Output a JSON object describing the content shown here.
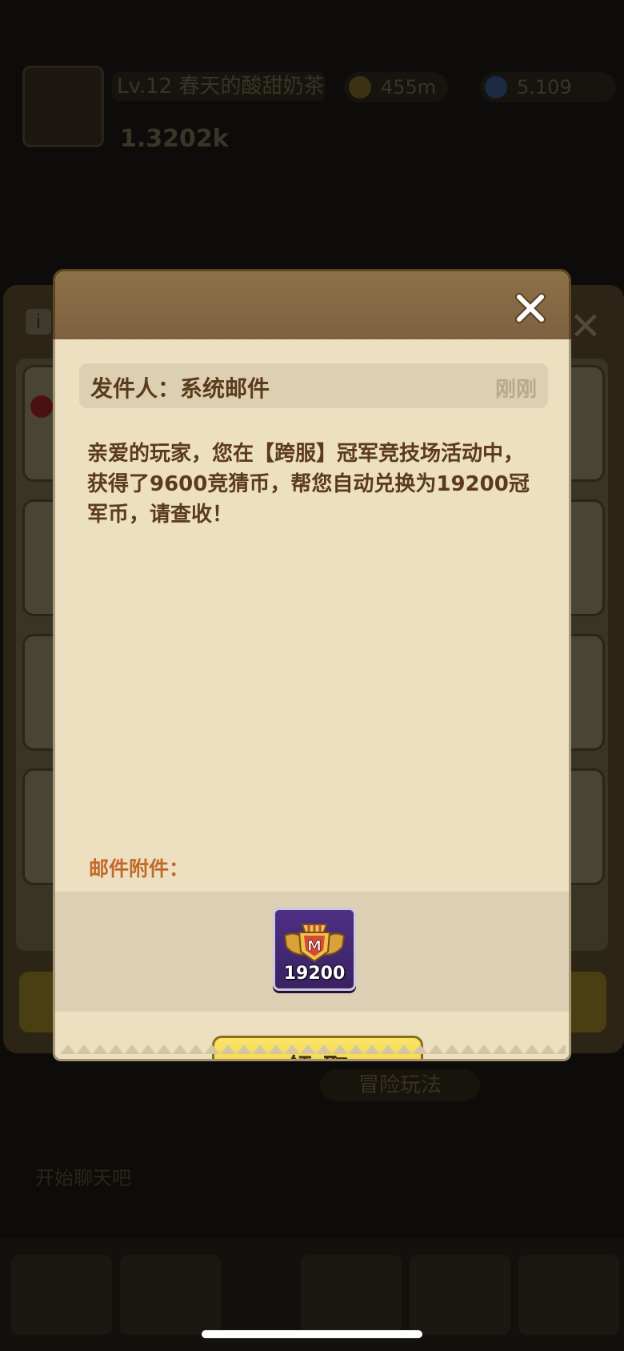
{
  "background": {
    "player_name": "Lv.12 春天的酸甜奶茶",
    "power": "1.3202k",
    "gold": "455m",
    "gems": "5.109",
    "adventure_label": "冒险玩法",
    "chat_placeholder": "开始聊天吧"
  },
  "mail_dialog": {
    "sender_label": "发件人：系统邮件",
    "time": "刚刚",
    "message": "亲爱的玩家，您在【跨服】冠军竞技场活动中，获得了9600竞猜币，帮您自动兑换为19200冠军币，请查收！",
    "attachments_label": "邮件附件：",
    "attachments": [
      {
        "name": "冠军币",
        "icon": "champion-coin-icon",
        "count": "19200"
      }
    ],
    "claim_label": "领取",
    "close_icon": "close-icon"
  },
  "colors": {
    "header": "#8d7048",
    "body": "#ece0c1",
    "claim_button": "#f2cd2a",
    "text": "#5c3a1c",
    "attachment_label": "#c2692a"
  }
}
